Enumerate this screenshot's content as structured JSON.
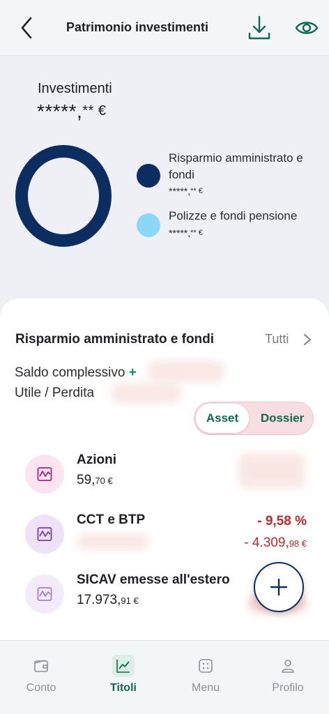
{
  "header": {
    "title": "Patrimonio investimenti"
  },
  "summary": {
    "label": "Investimenti",
    "total_main": "*****,",
    "total_dec": "** €"
  },
  "legend": [
    {
      "label": "Risparmio amministrato e fondi",
      "value_main": "*****,",
      "value_dec": "** €",
      "color": "#0b2d5f"
    },
    {
      "label": "Polizze e fondi pensione",
      "value_main": "*****,",
      "value_dec": "** €",
      "color": "#8ad8f7"
    }
  ],
  "section": {
    "title": "Risparmio amministrato e fondi",
    "all_label": "Tutti",
    "saldo_label": "Saldo complessivo",
    "saldo_plus": "+",
    "utile_label": "Utile / Perdita"
  },
  "toggle": {
    "asset": "Asset",
    "dossier": "Dossier"
  },
  "assets": [
    {
      "name": "Azioni",
      "value_main": "59,",
      "value_dec": "70 €",
      "perc": "",
      "delta_main": "",
      "delta_dec": ""
    },
    {
      "name": "CCT e BTP",
      "value_main": "",
      "value_dec": "",
      "perc": "- 9,58 %",
      "delta_main": "- 4.309,",
      "delta_dec": "98 €"
    },
    {
      "name": "SICAV emesse all'estero",
      "value_main": "17.973,",
      "value_dec": "91 €",
      "perc": "",
      "delta_main": "",
      "delta_dec": ""
    }
  ],
  "tabs": [
    {
      "label": "Conto"
    },
    {
      "label": "Titoli"
    },
    {
      "label": "Menu"
    },
    {
      "label": "Profilo"
    }
  ],
  "colors": {
    "accent": "#0b6b4a",
    "navy": "#0b2d5f",
    "loss": "#c0282b"
  }
}
